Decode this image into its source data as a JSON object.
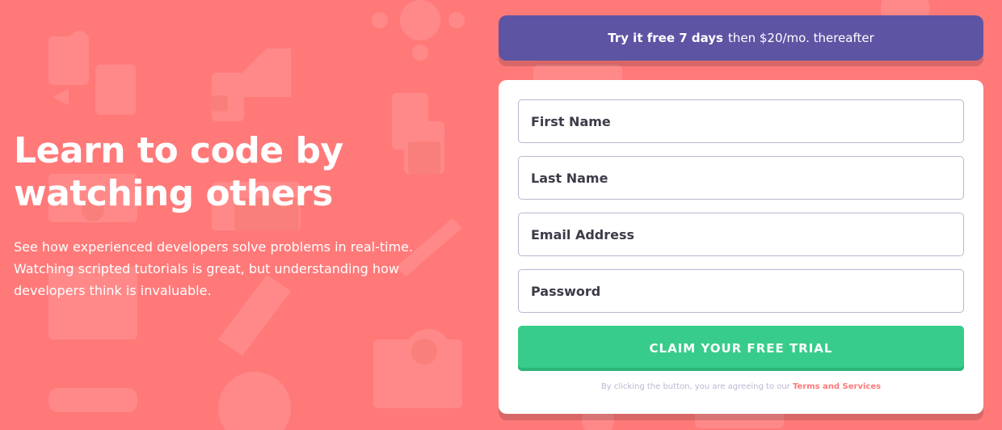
{
  "hero": {
    "heading_line1": "Learn to code by",
    "heading_line2": "watching others",
    "body": "See how experienced developers solve problems in real-time. Watching scripted tutorials is great, but understanding how developers think is invaluable."
  },
  "trial_banner": {
    "bold": "Try it free 7 days",
    "rest": "then $20/mo. thereafter"
  },
  "form": {
    "first_name_placeholder": "First Name",
    "last_name_placeholder": "Last Name",
    "email_placeholder": "Email Address",
    "password_placeholder": "Password",
    "submit_label": "CLAIM YOUR FREE TRIAL",
    "terms_prefix": "By clicking the button, you are agreeing to our",
    "terms_link": "Terms and Services"
  },
  "colors": {
    "background": "#ff7979",
    "banner": "#5e54a4",
    "button": "#38cc8b",
    "text_dark": "#3d3b48",
    "border": "#b9b6d3"
  }
}
